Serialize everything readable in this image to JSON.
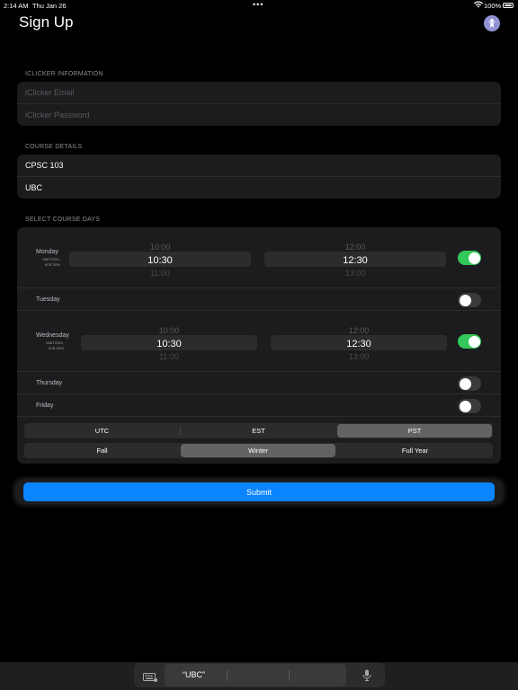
{
  "status_bar": {
    "time": "2:14 AM",
    "date": "Thu Jan 26",
    "more": "•••",
    "battery": "100%"
  },
  "header": {
    "title": "Sign Up"
  },
  "iclicker": {
    "section_label": "ICLICKER INFORMATION",
    "email_placeholder": "iClicker Email",
    "password_placeholder": "iClicker Password"
  },
  "course": {
    "section_label": "COURSE DETAILS",
    "course_value": "CPSC 103",
    "school_value": "UBC"
  },
  "days": {
    "section_label": "SELECT COURSE DAYS",
    "list": [
      {
        "name": "Monday",
        "sub1": "start time,",
        "sub2": "end time",
        "enabled": true,
        "start": {
          "prev": "10:00",
          "value": "10:30",
          "next": "11:00"
        },
        "end": {
          "prev": "12:00",
          "value": "12:30",
          "next": "13:00"
        }
      },
      {
        "name": "Tuesday",
        "enabled": false
      },
      {
        "name": "Wednesday",
        "sub1": "start time,",
        "sub2": "end time",
        "enabled": true,
        "start": {
          "prev": "10:00",
          "value": "10:30",
          "next": "11:00"
        },
        "end": {
          "prev": "12:00",
          "value": "12:30",
          "next": "13:00"
        }
      },
      {
        "name": "Thursday",
        "enabled": false
      },
      {
        "name": "Friday",
        "enabled": false
      }
    ]
  },
  "timezone": {
    "options": [
      "UTC",
      "EST",
      "PST"
    ],
    "selected": "PST"
  },
  "term": {
    "options": [
      "Fall",
      "Winter",
      "Full Year"
    ],
    "selected": "Winter"
  },
  "submit_label": "Submit",
  "keyboard": {
    "suggestion": "“UBC”"
  },
  "colors": {
    "accent": "#0a84ff",
    "toggle_on": "#34c759",
    "background": "#000000",
    "card": "#1c1c1e"
  }
}
